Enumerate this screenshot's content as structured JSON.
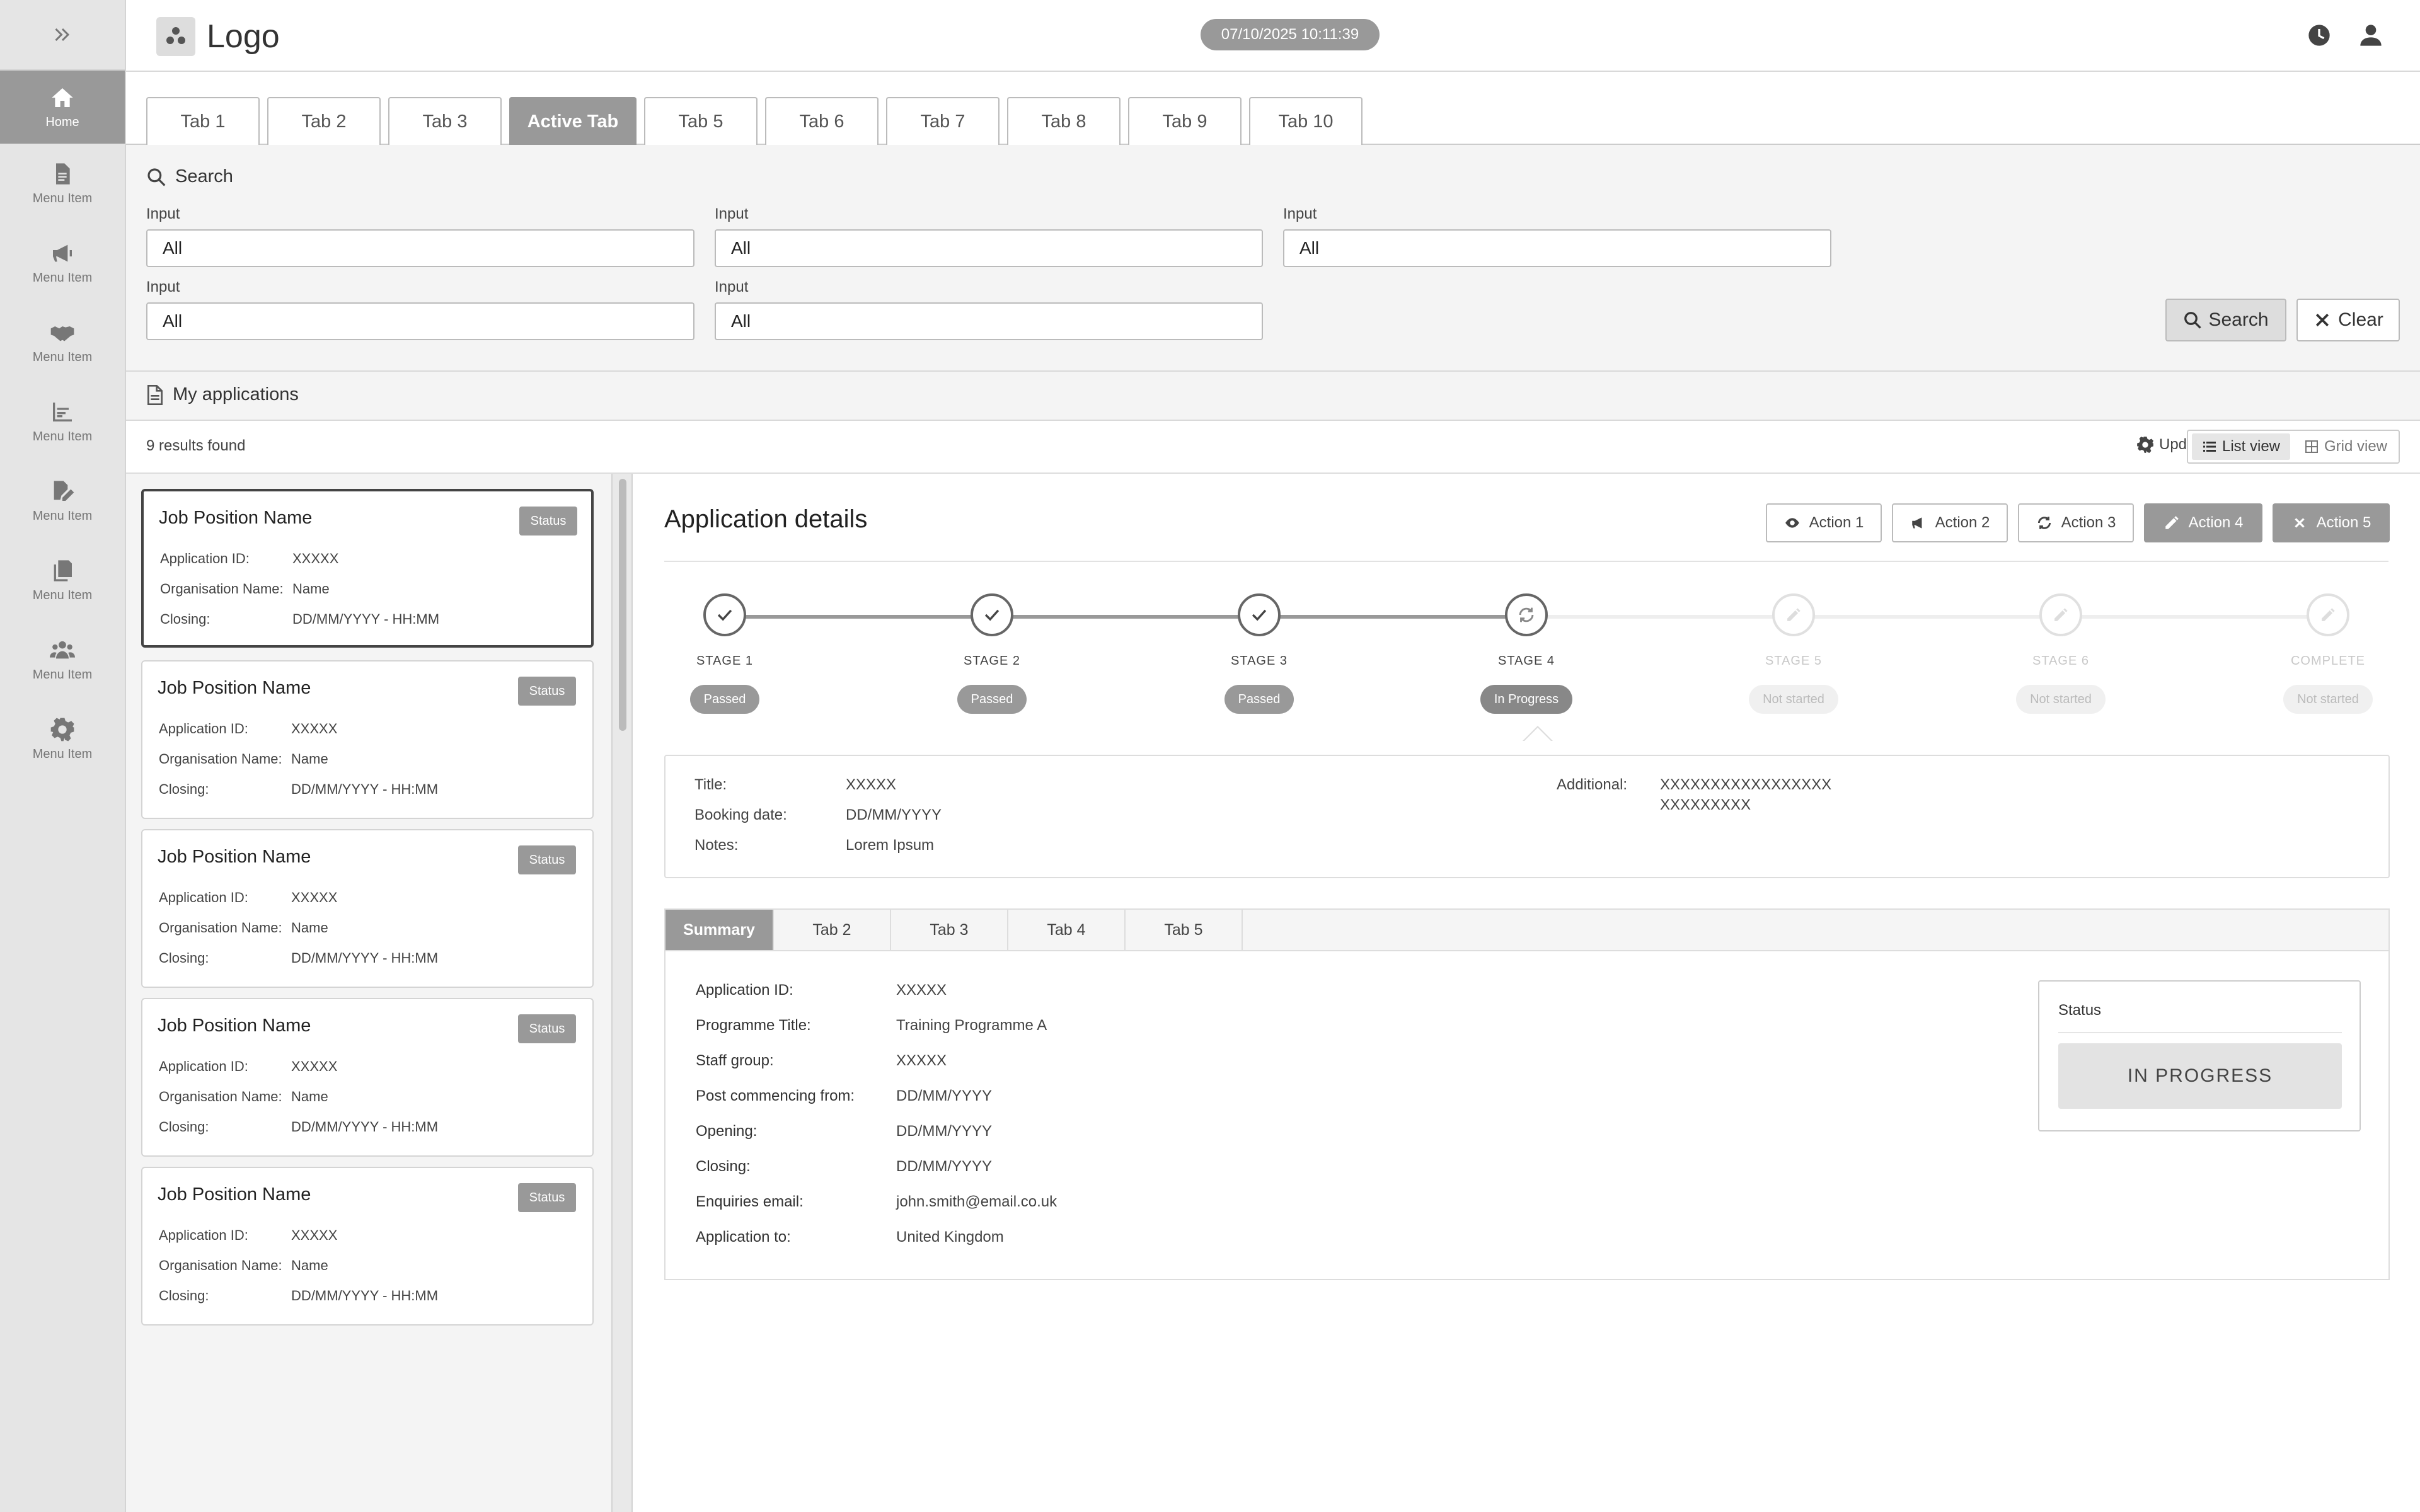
{
  "header": {
    "logo_text": "Logo",
    "datetime": "07/10/2025 10:11:39",
    "icons": [
      "clock-icon",
      "user-icon"
    ]
  },
  "sidebar": {
    "toggle_icon": "double-chevron-right-icon",
    "items": [
      {
        "label": "Home",
        "icon": "home-icon",
        "active": true
      },
      {
        "label": "Menu Item",
        "icon": "document-icon"
      },
      {
        "label": "Menu Item",
        "icon": "megaphone-icon"
      },
      {
        "label": "Menu Item",
        "icon": "handshake-icon"
      },
      {
        "label": "Menu Item",
        "icon": "bar-chart-icon"
      },
      {
        "label": "Menu Item",
        "icon": "edit-document-icon"
      },
      {
        "label": "Menu Item",
        "icon": "copy-icon"
      },
      {
        "label": "Menu Item",
        "icon": "users-icon"
      },
      {
        "label": "Menu Item",
        "icon": "gear-icon"
      }
    ]
  },
  "tabs": [
    "Tab 1",
    "Tab 2",
    "Tab 3",
    "Active Tab",
    "Tab 5",
    "Tab 6",
    "Tab 7",
    "Tab 8",
    "Tab 9",
    "Tab 10"
  ],
  "active_tab": "Active Tab",
  "search": {
    "title": "Search",
    "fields": [
      {
        "label": "Input",
        "value": "All"
      },
      {
        "label": "Input",
        "value": "All"
      },
      {
        "label": "Input",
        "value": "All"
      },
      {
        "label": "Input",
        "value": "All"
      },
      {
        "label": "Input",
        "value": "All"
      }
    ],
    "search_button": "Search",
    "clear_button": "Clear"
  },
  "my_apps": {
    "title": "My applications",
    "results": "9 results found",
    "update_prefs": "Update preferences",
    "list_view": "List view",
    "grid_view": "Grid view"
  },
  "cards": [
    {
      "title": "Job Position Name",
      "status": "Status",
      "app_id_label": "Application ID:",
      "app_id": "XXXXX",
      "org_label": "Organisation Name:",
      "org": "Name",
      "closing_label": "Closing:",
      "closing": "DD/MM/YYYY - HH:MM",
      "selected": true
    },
    {
      "title": "Job Position Name",
      "status": "Status",
      "app_id_label": "Application ID:",
      "app_id": "XXXXX",
      "org_label": "Organisation Name:",
      "org": "Name",
      "closing_label": "Closing:",
      "closing": "DD/MM/YYYY - HH:MM"
    },
    {
      "title": "Job Position Name",
      "status": "Status",
      "app_id_label": "Application ID:",
      "app_id": "XXXXX",
      "org_label": "Organisation Name:",
      "org": "Name",
      "closing_label": "Closing:",
      "closing": "DD/MM/YYYY - HH:MM"
    },
    {
      "title": "Job Position Name",
      "status": "Status",
      "app_id_label": "Application ID:",
      "app_id": "XXXXX",
      "org_label": "Organisation Name:",
      "org": "Name",
      "closing_label": "Closing:",
      "closing": "DD/MM/YYYY - HH:MM"
    },
    {
      "title": "Job Position Name",
      "status": "Status",
      "app_id_label": "Application ID:",
      "app_id": "XXXXX",
      "org_label": "Organisation Name:",
      "org": "Name",
      "closing_label": "Closing:",
      "closing": "DD/MM/YYYY - HH:MM"
    }
  ],
  "detail": {
    "title": "Application details",
    "actions": [
      {
        "label": "Action 1",
        "icon": "eye-icon"
      },
      {
        "label": "Action 2",
        "icon": "megaphone-icon"
      },
      {
        "label": "Action 3",
        "icon": "refresh-icon"
      },
      {
        "label": "Action 4",
        "icon": "pencil-icon"
      },
      {
        "label": "Action 5",
        "icon": "close-icon"
      }
    ],
    "stages": [
      {
        "label": "STAGE 1",
        "status": "Passed",
        "state": "done"
      },
      {
        "label": "STAGE 2",
        "status": "Passed",
        "state": "done"
      },
      {
        "label": "STAGE 3",
        "status": "Passed",
        "state": "done"
      },
      {
        "label": "STAGE 4",
        "status": "In Progress",
        "state": "current"
      },
      {
        "label": "STAGE 5",
        "status": "Not started",
        "state": "pending"
      },
      {
        "label": "STAGE 6",
        "status": "Not started",
        "state": "pending"
      },
      {
        "label": "COMPLETE",
        "status": "Not started",
        "state": "pending"
      }
    ],
    "info": {
      "title_label": "Title:",
      "title_value": "XXXXX",
      "booking_label": "Booking date:",
      "booking_value": "DD/MM/YYYY",
      "notes_label": "Notes:",
      "notes_value": "Lorem Ipsum",
      "additional_label": "Additional:",
      "additional_line1": "XXXXXXXXXXXXXXXXX",
      "additional_line2": "XXXXXXXXX"
    },
    "subtabs": [
      "Summary",
      "Tab 2",
      "Tab 3",
      "Tab 4",
      "Tab 5"
    ],
    "summary": [
      {
        "label": "Application ID:",
        "value": "XXXXX"
      },
      {
        "label": "Programme Title:",
        "value": "Training Programme A"
      },
      {
        "label": "Staff group:",
        "value": "XXXXX"
      },
      {
        "label": "Post commencing from:",
        "value": "DD/MM/YYYY"
      },
      {
        "label": "Opening:",
        "value": "DD/MM/YYYY"
      },
      {
        "label": "Closing:",
        "value": "DD/MM/YYYY"
      },
      {
        "label": "Enquiries email:",
        "value": "john.smith@email.co.uk"
      },
      {
        "label": "Application to:",
        "value": "United Kingdom"
      }
    ],
    "status_card": {
      "title": "Status",
      "value": "IN PROGRESS"
    }
  }
}
